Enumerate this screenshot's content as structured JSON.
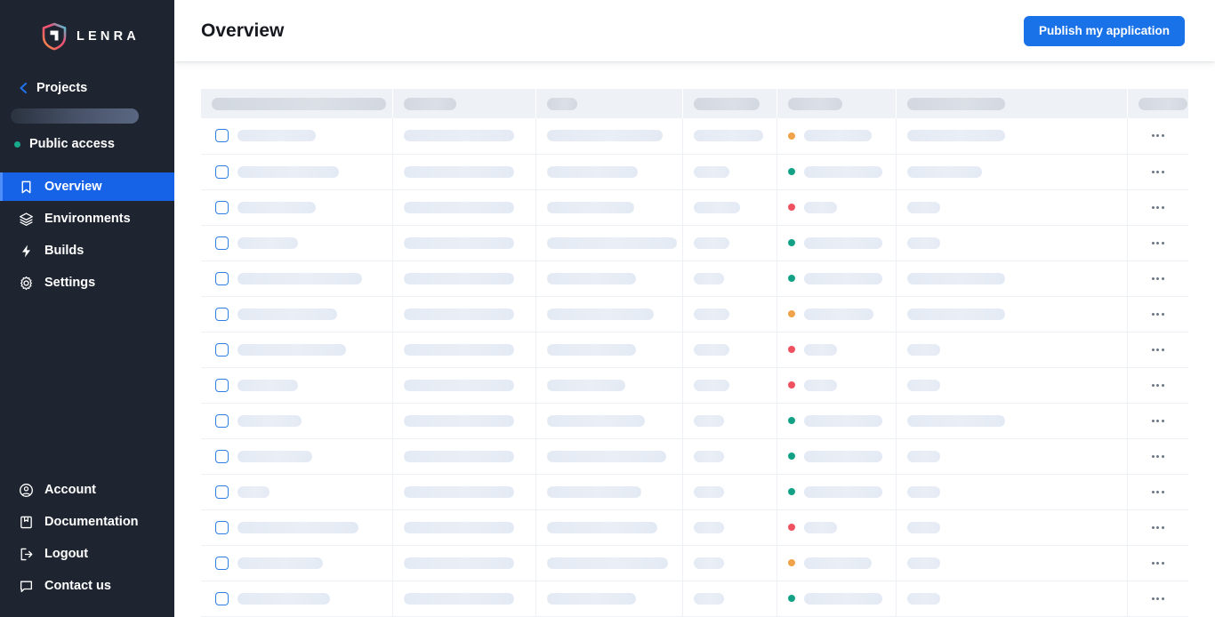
{
  "brand": {
    "name": "LENRA",
    "logo_icon": "lenra-shield-logo"
  },
  "sidebar": {
    "back_link": {
      "label": "Projects",
      "icon": "chevron-left-icon"
    },
    "project_name_skeleton": "",
    "access": {
      "label": "Public access",
      "status_color": "#19a98b",
      "dot_icon": "status-dot-icon"
    },
    "nav": [
      {
        "label": "Overview",
        "icon": "bookmark-icon",
        "active": true
      },
      {
        "label": "Environments",
        "icon": "layers-icon",
        "active": false
      },
      {
        "label": "Builds",
        "icon": "bolt-icon",
        "active": false
      },
      {
        "label": "Settings",
        "icon": "gear-icon",
        "active": false
      }
    ],
    "nav_bottom": [
      {
        "label": "Account",
        "icon": "user-circle-icon"
      },
      {
        "label": "Documentation",
        "icon": "book-icon"
      },
      {
        "label": "Logout",
        "icon": "logout-icon"
      },
      {
        "label": "Contact us",
        "icon": "message-square-icon"
      }
    ],
    "active_color": "#1663e8",
    "background_color": "#1e2430"
  },
  "header": {
    "title": "Overview",
    "publish_button": {
      "label": "Publish my application",
      "color": "#1a72e8"
    }
  },
  "table": {
    "loading": true,
    "header_widths": [
      196,
      59,
      34,
      74,
      61,
      110,
      55
    ],
    "status_colors": {
      "pending": "#f0a34b",
      "success": "#13a185",
      "error": "#f0505f"
    },
    "rows": [
      {
        "name_w": 88,
        "col2_w": 124,
        "col3_w": 130,
        "col4_w": 78,
        "status": "pending",
        "col5_w": 76,
        "col6_w": 110,
        "menu_icon": "more-horizontal-icon"
      },
      {
        "name_w": 114,
        "col2_w": 124,
        "col3_w": 102,
        "col4_w": 40,
        "status": "success",
        "col5_w": 88,
        "col6_w": 84,
        "menu_icon": "more-horizontal-icon"
      },
      {
        "name_w": 88,
        "col2_w": 124,
        "col3_w": 98,
        "col4_w": 52,
        "status": "error",
        "col5_w": 37,
        "col6_w": 37,
        "menu_icon": "more-horizontal-icon"
      },
      {
        "name_w": 68,
        "col2_w": 124,
        "col3_w": 146,
        "col4_w": 40,
        "status": "success",
        "col5_w": 88,
        "col6_w": 37,
        "menu_icon": "more-horizontal-icon"
      },
      {
        "name_w": 140,
        "col2_w": 124,
        "col3_w": 100,
        "col4_w": 34,
        "status": "success",
        "col5_w": 88,
        "col6_w": 110,
        "menu_icon": "more-horizontal-icon"
      },
      {
        "name_w": 112,
        "col2_w": 124,
        "col3_w": 120,
        "col4_w": 40,
        "status": "pending",
        "col5_w": 78,
        "col6_w": 110,
        "menu_icon": "more-horizontal-icon"
      },
      {
        "name_w": 122,
        "col2_w": 124,
        "col3_w": 100,
        "col4_w": 40,
        "status": "error",
        "col5_w": 37,
        "col6_w": 37,
        "menu_icon": "more-horizontal-icon"
      },
      {
        "name_w": 68,
        "col2_w": 124,
        "col3_w": 88,
        "col4_w": 40,
        "status": "error",
        "col5_w": 37,
        "col6_w": 37,
        "menu_icon": "more-horizontal-icon"
      },
      {
        "name_w": 72,
        "col2_w": 124,
        "col3_w": 110,
        "col4_w": 34,
        "status": "success",
        "col5_w": 88,
        "col6_w": 110,
        "menu_icon": "more-horizontal-icon"
      },
      {
        "name_w": 84,
        "col2_w": 124,
        "col3_w": 134,
        "col4_w": 34,
        "status": "success",
        "col5_w": 88,
        "col6_w": 37,
        "menu_icon": "more-horizontal-icon"
      },
      {
        "name_w": 36,
        "col2_w": 124,
        "col3_w": 106,
        "col4_w": 34,
        "status": "success",
        "col5_w": 88,
        "col6_w": 37,
        "menu_icon": "more-horizontal-icon"
      },
      {
        "name_w": 136,
        "col2_w": 124,
        "col3_w": 124,
        "col4_w": 34,
        "status": "error",
        "col5_w": 37,
        "col6_w": 37,
        "menu_icon": "more-horizontal-icon"
      },
      {
        "name_w": 96,
        "col2_w": 124,
        "col3_w": 136,
        "col4_w": 34,
        "status": "pending",
        "col5_w": 76,
        "col6_w": 37,
        "menu_icon": "more-horizontal-icon"
      },
      {
        "name_w": 104,
        "col2_w": 124,
        "col3_w": 100,
        "col4_w": 34,
        "status": "success",
        "col5_w": 88,
        "col6_w": 37,
        "menu_icon": "more-horizontal-icon"
      }
    ]
  }
}
